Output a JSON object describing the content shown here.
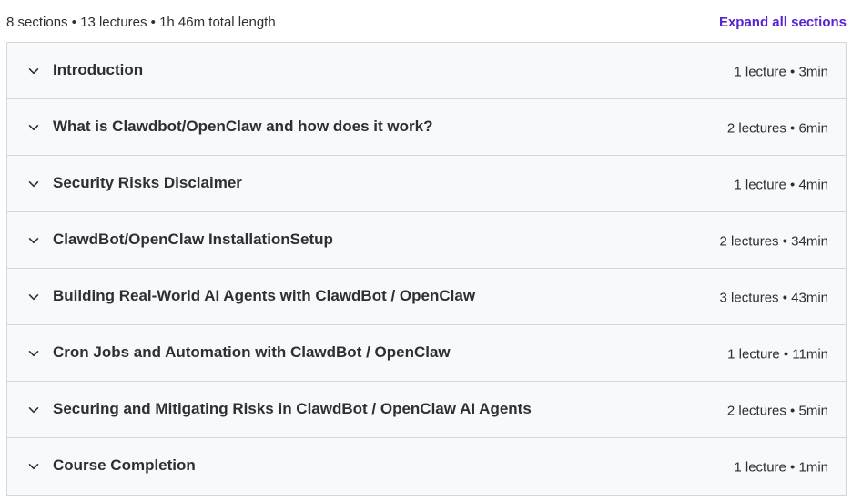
{
  "summary": {
    "text": "8 sections • 13 lectures • 1h 46m total length",
    "expand_label": "Expand all sections"
  },
  "colors": {
    "accent": "#5624d0",
    "row_bg": "#f7f9fa",
    "border": "#d1d7dc",
    "text": "#2d2f31"
  },
  "sections": [
    {
      "title": "Introduction",
      "meta": "1 lecture • 3min",
      "icon": "chevron-down-icon"
    },
    {
      "title": "What is Clawdbot/OpenClaw and how does it work?",
      "meta": "2 lectures • 6min",
      "icon": "chevron-down-icon"
    },
    {
      "title": "Security Risks Disclaimer",
      "meta": "1 lecture • 4min",
      "icon": "chevron-down-icon"
    },
    {
      "title": "ClawdBot/OpenClaw InstallationSetup",
      "meta": "2 lectures • 34min",
      "icon": "chevron-down-icon"
    },
    {
      "title": "Building Real-World AI Agents with ClawdBot / OpenClaw",
      "meta": "3 lectures • 43min",
      "icon": "chevron-down-icon"
    },
    {
      "title": "Cron Jobs and Automation with ClawdBot / OpenClaw",
      "meta": "1 lecture • 11min",
      "icon": "chevron-down-icon"
    },
    {
      "title": "Securing and Mitigating Risks in ClawdBot / OpenClaw AI Agents",
      "meta": "2 lectures • 5min",
      "icon": "chevron-down-icon"
    },
    {
      "title": "Course Completion",
      "meta": "1 lecture • 1min",
      "icon": "chevron-down-icon"
    }
  ]
}
